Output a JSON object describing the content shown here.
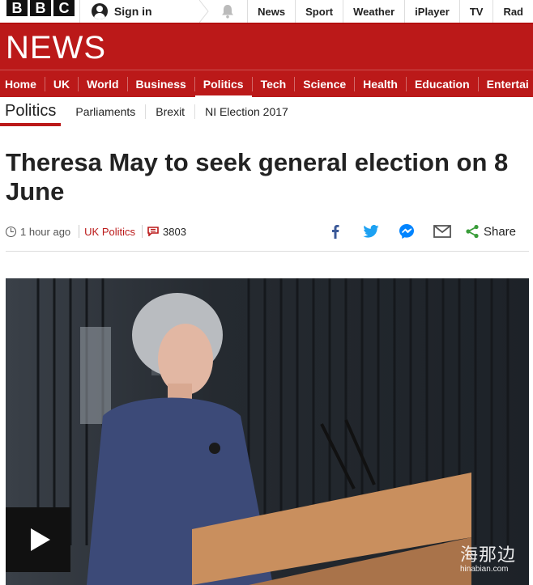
{
  "topbar": {
    "logo_letters": [
      "B",
      "B",
      "C"
    ],
    "signin_label": "Sign in",
    "nav": [
      "News",
      "Sport",
      "Weather",
      "iPlayer",
      "TV",
      "Rad"
    ]
  },
  "banner": {
    "title": "NEWS"
  },
  "section_nav": {
    "items": [
      "Home",
      "UK",
      "World",
      "Business",
      "Politics",
      "Tech",
      "Science",
      "Health",
      "Education",
      "Entertai"
    ],
    "active": "Politics"
  },
  "sub_nav": {
    "current": "Politics",
    "items": [
      "Parliaments",
      "Brexit",
      "NI Election 2017"
    ]
  },
  "article": {
    "headline": "Theresa May to seek general election on 8 June",
    "time": "1 hour ago",
    "tag": "UK Politics",
    "comment_count": "3803",
    "share_label": "Share"
  },
  "media": {
    "watermark_cn": "海那边",
    "watermark_url": "hinabian.com"
  },
  "colors": {
    "brand_red": "#bb1919",
    "facebook": "#3b5998",
    "twitter": "#1da1f2",
    "messenger": "#0084ff",
    "share_green": "#3a9d3a"
  }
}
